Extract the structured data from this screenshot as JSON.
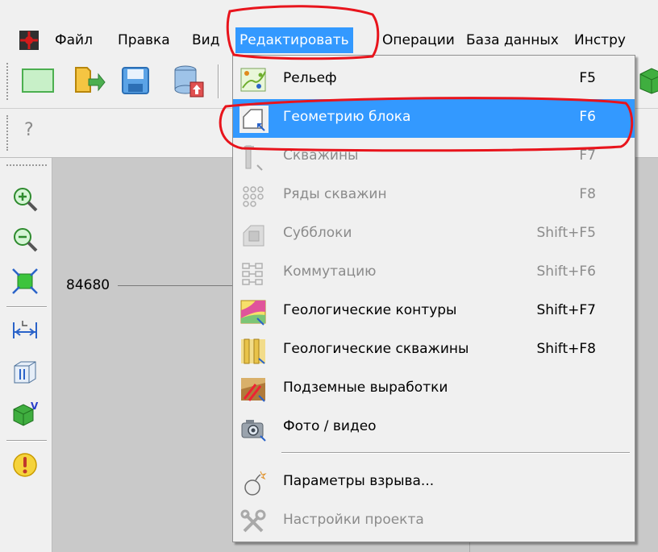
{
  "menubar": {
    "items": [
      "Файл",
      "Правка",
      "Вид",
      "Редактировать",
      "Операции",
      "База данных",
      "Инстру"
    ]
  },
  "toolbar2": {
    "help_label": "?"
  },
  "canvas": {
    "coordinate": "84680"
  },
  "dropdown": {
    "items": [
      {
        "label": "Рельеф",
        "shortcut": "F5",
        "icon": "relief-icon",
        "enabled": true
      },
      {
        "label": "Геометрию блока",
        "shortcut": "F6",
        "icon": "block-geometry-icon",
        "enabled": true,
        "selected": true
      },
      {
        "label": "Скважины",
        "shortcut": "F7",
        "icon": "wells-icon",
        "enabled": false
      },
      {
        "label": "Ряды скважин",
        "shortcut": "F8",
        "icon": "well-rows-icon",
        "enabled": false
      },
      {
        "label": "Субблоки",
        "shortcut": "Shift+F5",
        "icon": "subblocks-icon",
        "enabled": false
      },
      {
        "label": "Коммутацию",
        "shortcut": "Shift+F6",
        "icon": "commutation-icon",
        "enabled": false
      },
      {
        "label": "Геологические контуры",
        "shortcut": "Shift+F7",
        "icon": "geological-contours-icon",
        "enabled": true
      },
      {
        "label": "Геологические скважины",
        "shortcut": "Shift+F8",
        "icon": "geological-wells-icon",
        "enabled": true
      },
      {
        "label": "Подземные выработки",
        "shortcut": "",
        "icon": "underground-workings-icon",
        "enabled": true
      },
      {
        "label": "Фото / видео",
        "shortcut": "",
        "icon": "camera-icon",
        "enabled": true
      },
      {
        "label": "Параметры взрыва...",
        "shortcut": "",
        "icon": "bomb-icon",
        "enabled": true
      },
      {
        "label": "Настройки проекта",
        "shortcut": "",
        "icon": "tools-icon",
        "enabled": false
      }
    ]
  },
  "colors": {
    "selection": "#3399ff",
    "annotation": "#e8141c",
    "disabled_text": "#8b8b8b"
  }
}
